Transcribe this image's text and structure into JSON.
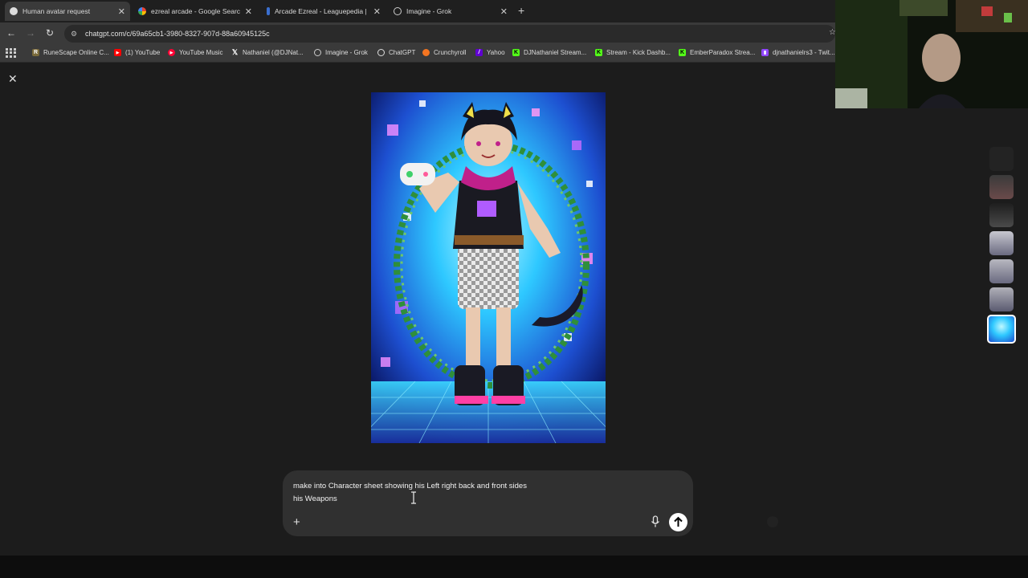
{
  "tabs": [
    {
      "label": "Human avatar request",
      "favicon": "chatgpt-icon",
      "active": true
    },
    {
      "label": "ezreal arcade - Google Search",
      "favicon": "google-icon"
    },
    {
      "label": "Arcade Ezreal - Leaguepedia | L",
      "favicon": "leaguepedia-icon"
    },
    {
      "label": "Imagine - Grok",
      "favicon": "grok-icon"
    }
  ],
  "address": {
    "url": "chatgpt.com/c/69a65cb1-3980-8327-907d-88a60945125c"
  },
  "bookmarks": [
    {
      "label": "RuneScape Online C...",
      "icon": "runescape-icon",
      "color": "#7a6a3a"
    },
    {
      "label": "(1) YouTube",
      "icon": "youtube-icon",
      "color": "#ff0000"
    },
    {
      "label": "YouTube Music",
      "icon": "youtube-music-icon",
      "color": "#ff0033"
    },
    {
      "label": "Nathaniel (@DJNat...",
      "icon": "x-icon",
      "color": "#000000"
    },
    {
      "label": "Imagine - Grok",
      "icon": "grok-icon",
      "color": "#222222"
    },
    {
      "label": "ChatGPT",
      "icon": "chatgpt-icon",
      "color": "#222222"
    },
    {
      "label": "Crunchyroll",
      "icon": "crunchyroll-icon",
      "color": "#f47521"
    },
    {
      "label": "Yahoo",
      "icon": "yahoo-icon",
      "color": "#6001d2"
    },
    {
      "label": "DJNathaniel Stream...",
      "icon": "kick-icon",
      "color": "#53fc18"
    },
    {
      "label": "Stream - Kick Dashb...",
      "icon": "kick-icon",
      "color": "#53fc18"
    },
    {
      "label": "EmberParadox Strea...",
      "icon": "kick-icon",
      "color": "#53fc18"
    },
    {
      "label": "djnathanielrs3 - Twit...",
      "icon": "twitch-icon",
      "color": "#9146ff"
    }
  ],
  "composer": {
    "prompt_text": "make into Character sheet showing his Left right back and front sides\nhis Weapons"
  },
  "colors": {
    "page_bg": "#1c1c1c",
    "composer_bg": "#303030",
    "accent_cyan": "#20c8ff",
    "accent_magenta": "#e040c8"
  }
}
